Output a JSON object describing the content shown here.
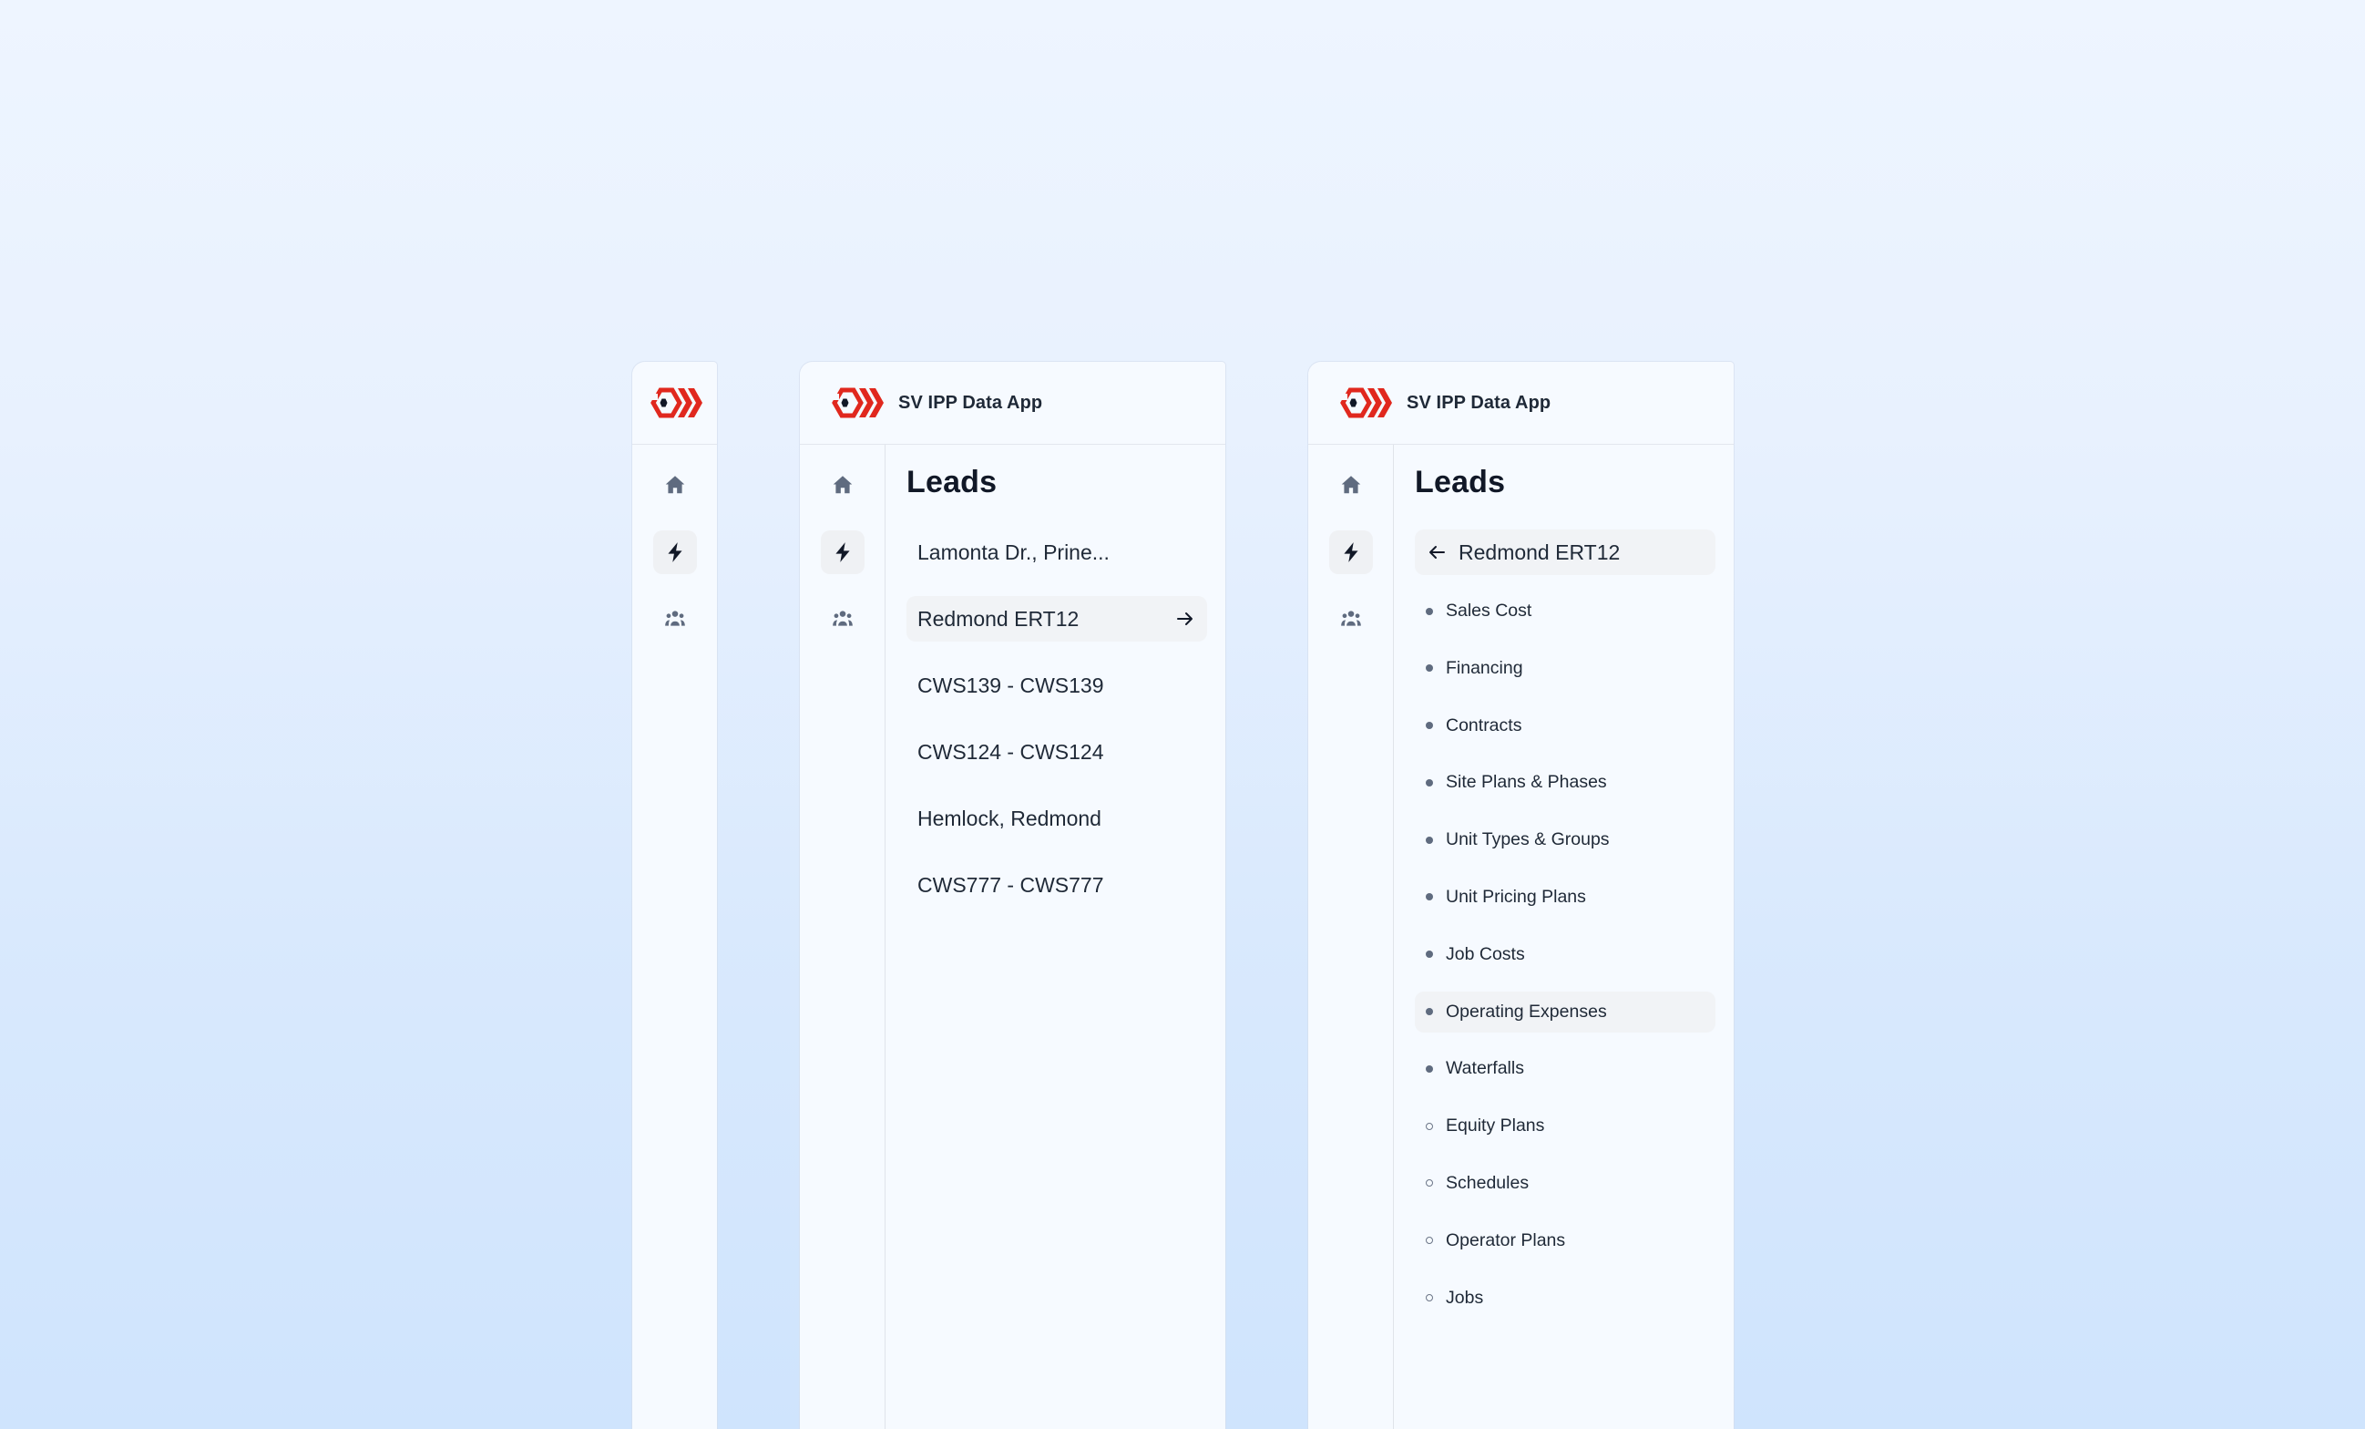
{
  "app": {
    "title": "SV IPP Data App",
    "brand_color": "#e0281e",
    "logo_icon": "brand-logo-hexagon-chevrons"
  },
  "rail": {
    "items": [
      {
        "name": "home",
        "icon": "home-icon",
        "active": false
      },
      {
        "name": "leads",
        "icon": "lightning-bolt-icon",
        "active": true
      },
      {
        "name": "team",
        "icon": "users-group-icon",
        "active": false
      }
    ]
  },
  "leads_panel": {
    "title": "Leads",
    "items": [
      {
        "label": "Lamonta Dr., Prine...",
        "selected": false
      },
      {
        "label": "Redmond ERT12",
        "selected": true
      },
      {
        "label": "CWS139 - CWS139",
        "selected": false
      },
      {
        "label": "CWS124 - CWS124",
        "selected": false
      },
      {
        "label": "Hemlock, Redmond",
        "selected": false
      },
      {
        "label": "CWS777 - CWS777",
        "selected": false
      }
    ]
  },
  "detail_panel": {
    "title": "Leads",
    "back_label": "Redmond ERT12",
    "sections": [
      {
        "label": "Sales Cost",
        "completed": true,
        "selected": false
      },
      {
        "label": "Financing",
        "completed": true,
        "selected": false
      },
      {
        "label": "Contracts",
        "completed": true,
        "selected": false
      },
      {
        "label": "Site Plans & Phases",
        "completed": true,
        "selected": false
      },
      {
        "label": "Unit Types & Groups",
        "completed": true,
        "selected": false
      },
      {
        "label": "Unit Pricing Plans",
        "completed": true,
        "selected": false
      },
      {
        "label": "Job Costs",
        "completed": true,
        "selected": false
      },
      {
        "label": "Operating Expenses",
        "completed": true,
        "selected": true
      },
      {
        "label": "Waterfalls",
        "completed": true,
        "selected": false
      },
      {
        "label": "Equity Plans",
        "completed": false,
        "selected": false
      },
      {
        "label": "Schedules",
        "completed": false,
        "selected": false
      },
      {
        "label": "Operator Plans",
        "completed": false,
        "selected": false
      },
      {
        "label": "Jobs",
        "completed": false,
        "selected": false
      }
    ]
  }
}
